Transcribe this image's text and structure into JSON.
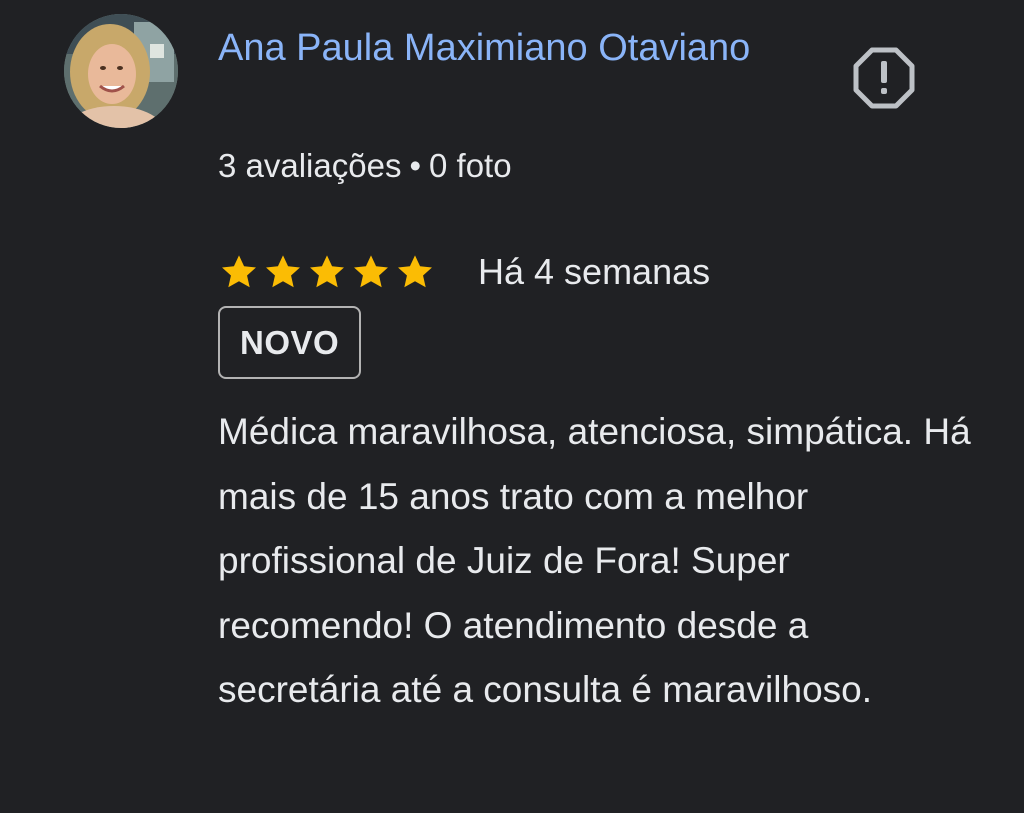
{
  "review": {
    "author": {
      "name": "Ana Paula Maximiano Otaviano",
      "reviews_count": "3 avaliações",
      "separator": "•",
      "photos_count": "0 foto",
      "avatar_icon": "user-avatar-photo"
    },
    "report_icon": "report-flag-icon",
    "rating": {
      "stars": 5,
      "max": 5,
      "star_color": "#fbbc04"
    },
    "date": "Há 4 semanas",
    "badge": "NOVO",
    "text": "Médica maravilhosa, atenciosa, simpática. Há mais de 15 anos trato com a melhor profissional de Juiz de Fora! Super recomendo! O atendimento desde a secretária até a consulta é maravilhoso."
  },
  "colors": {
    "background": "#202124",
    "author_name": "#8ab4f8",
    "text": "#e8eaed",
    "badge_border": "#b3b3b3",
    "icon_gray": "#bdc1c6"
  }
}
